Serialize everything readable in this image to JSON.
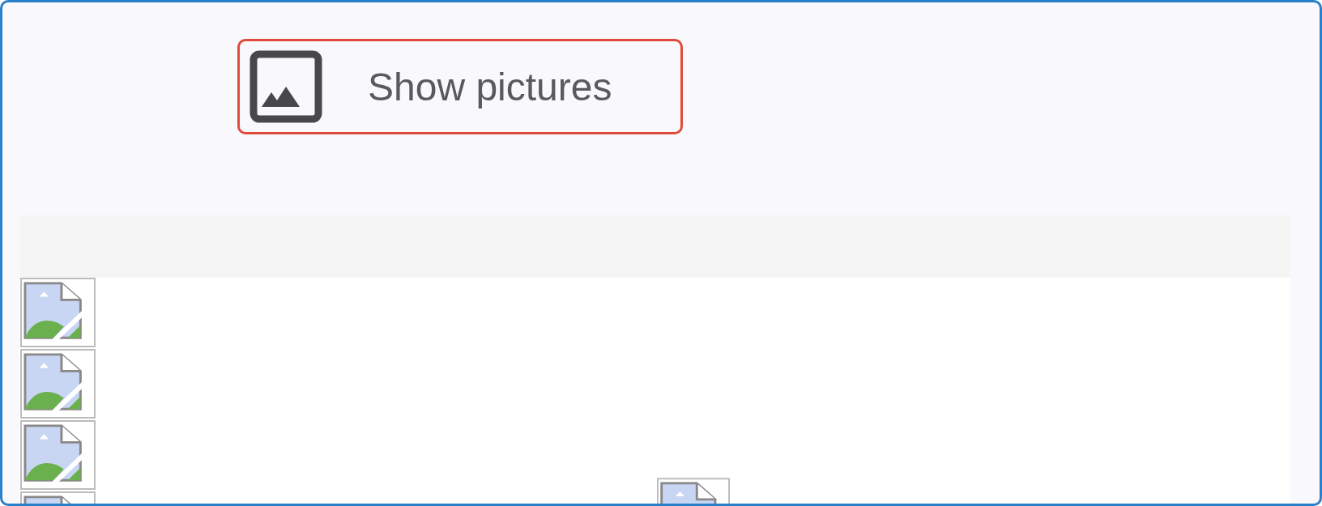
{
  "toolbar": {
    "show_pictures_button": {
      "label": "Show pictures"
    }
  }
}
